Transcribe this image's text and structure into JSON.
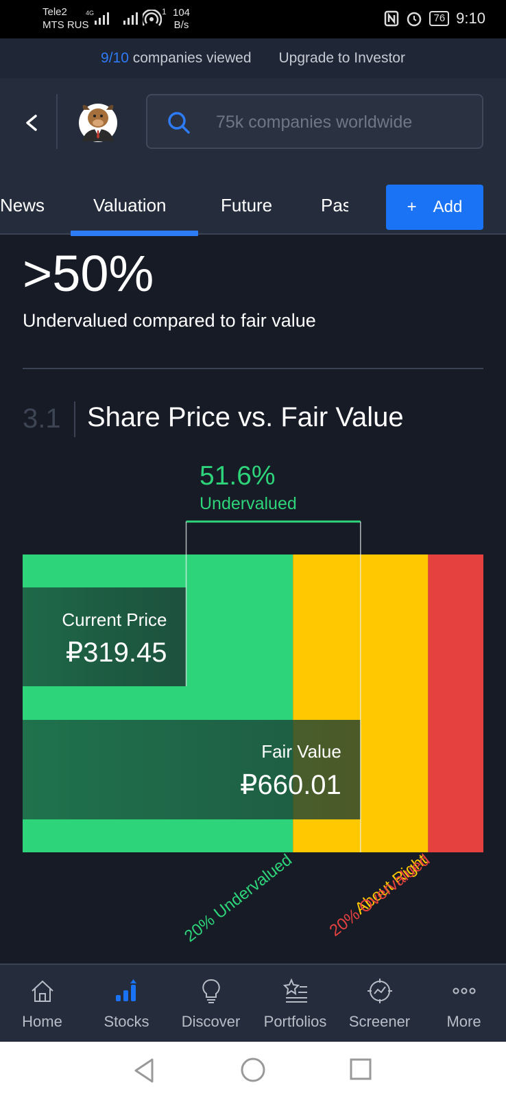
{
  "status_bar": {
    "carrier1": "Tele2",
    "carrier2": "MTS RUS",
    "network": "4G",
    "speed_value": "104",
    "speed_unit": "B/s",
    "speed_prefix": "1",
    "battery": "76",
    "time": "9:10"
  },
  "banner": {
    "count": "9/10",
    "count_suffix": " companies viewed",
    "upgrade": "Upgrade to Investor"
  },
  "header": {
    "search_placeholder": "75k companies worldwide",
    "tabs": [
      "News",
      "Valuation",
      "Future",
      "Pas"
    ],
    "active_tab": "Valuation",
    "add_plus": "+",
    "add_label": "Add"
  },
  "summary": {
    "headline": ">50%",
    "subtitle": "Undervalued compared to fair value"
  },
  "section": {
    "number": "3.1",
    "title": "Share Price vs. Fair Value"
  },
  "valuation": {
    "discount_pct": "51.6%",
    "discount_label": "Undervalued",
    "current_price_label": "Current Price",
    "current_price": "₽319.45",
    "fair_value_label": "Fair Value",
    "fair_value": "₽660.01",
    "zone_labels": [
      "20% Undervalued",
      "About Right",
      "20% Overvalued"
    ]
  },
  "chart_data": {
    "type": "bar",
    "categories": [
      "Current Price",
      "Fair Value"
    ],
    "values": [
      319.45,
      660.01
    ],
    "zones": [
      {
        "name": "20% Undervalued",
        "from": 0,
        "to": 528.01,
        "color": "#2ed47a"
      },
      {
        "name": "About Right",
        "from": 528.01,
        "to": 792.01,
        "color": "#ffc800"
      },
      {
        "name": "20% Overvalued",
        "from": 792.01,
        "to": 900,
        "color": "#e5413f"
      }
    ],
    "xlim": [
      0,
      900
    ]
  },
  "colors": {
    "green": "#2ed47a",
    "yellow": "#ffc800",
    "red": "#e5413f",
    "accent": "#1a73f5"
  },
  "bottom_nav": [
    {
      "label": "Home",
      "icon": "home-icon"
    },
    {
      "label": "Stocks",
      "icon": "stocks-icon"
    },
    {
      "label": "Discover",
      "icon": "lightbulb-icon"
    },
    {
      "label": "Portfolios",
      "icon": "portfolio-star-icon"
    },
    {
      "label": "Screener",
      "icon": "screener-crosshair-icon"
    },
    {
      "label": "More",
      "icon": "more-dots-icon"
    }
  ]
}
